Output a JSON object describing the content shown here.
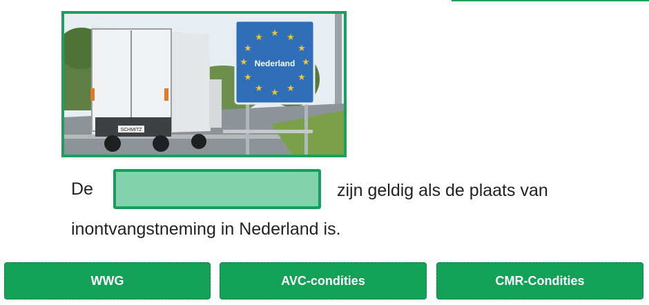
{
  "photo": {
    "sign_text": "Nederland",
    "plate_text": "SCHMITZ",
    "colors": {
      "sign_blue": "#2f6fb8",
      "star_yellow": "#f2c230",
      "frame_green": "#1aa05a"
    }
  },
  "question": {
    "before_blank": "De",
    "after_blank": "zijn geldig als de plaats van",
    "line2": "inontvangstneming in Nederland is."
  },
  "choices": [
    {
      "label": "WWG"
    },
    {
      "label": "AVC-condities"
    },
    {
      "label": "CMR-Condities"
    }
  ],
  "colors": {
    "accent": "#12a157",
    "dropzone_fill": "#82d3ad"
  }
}
